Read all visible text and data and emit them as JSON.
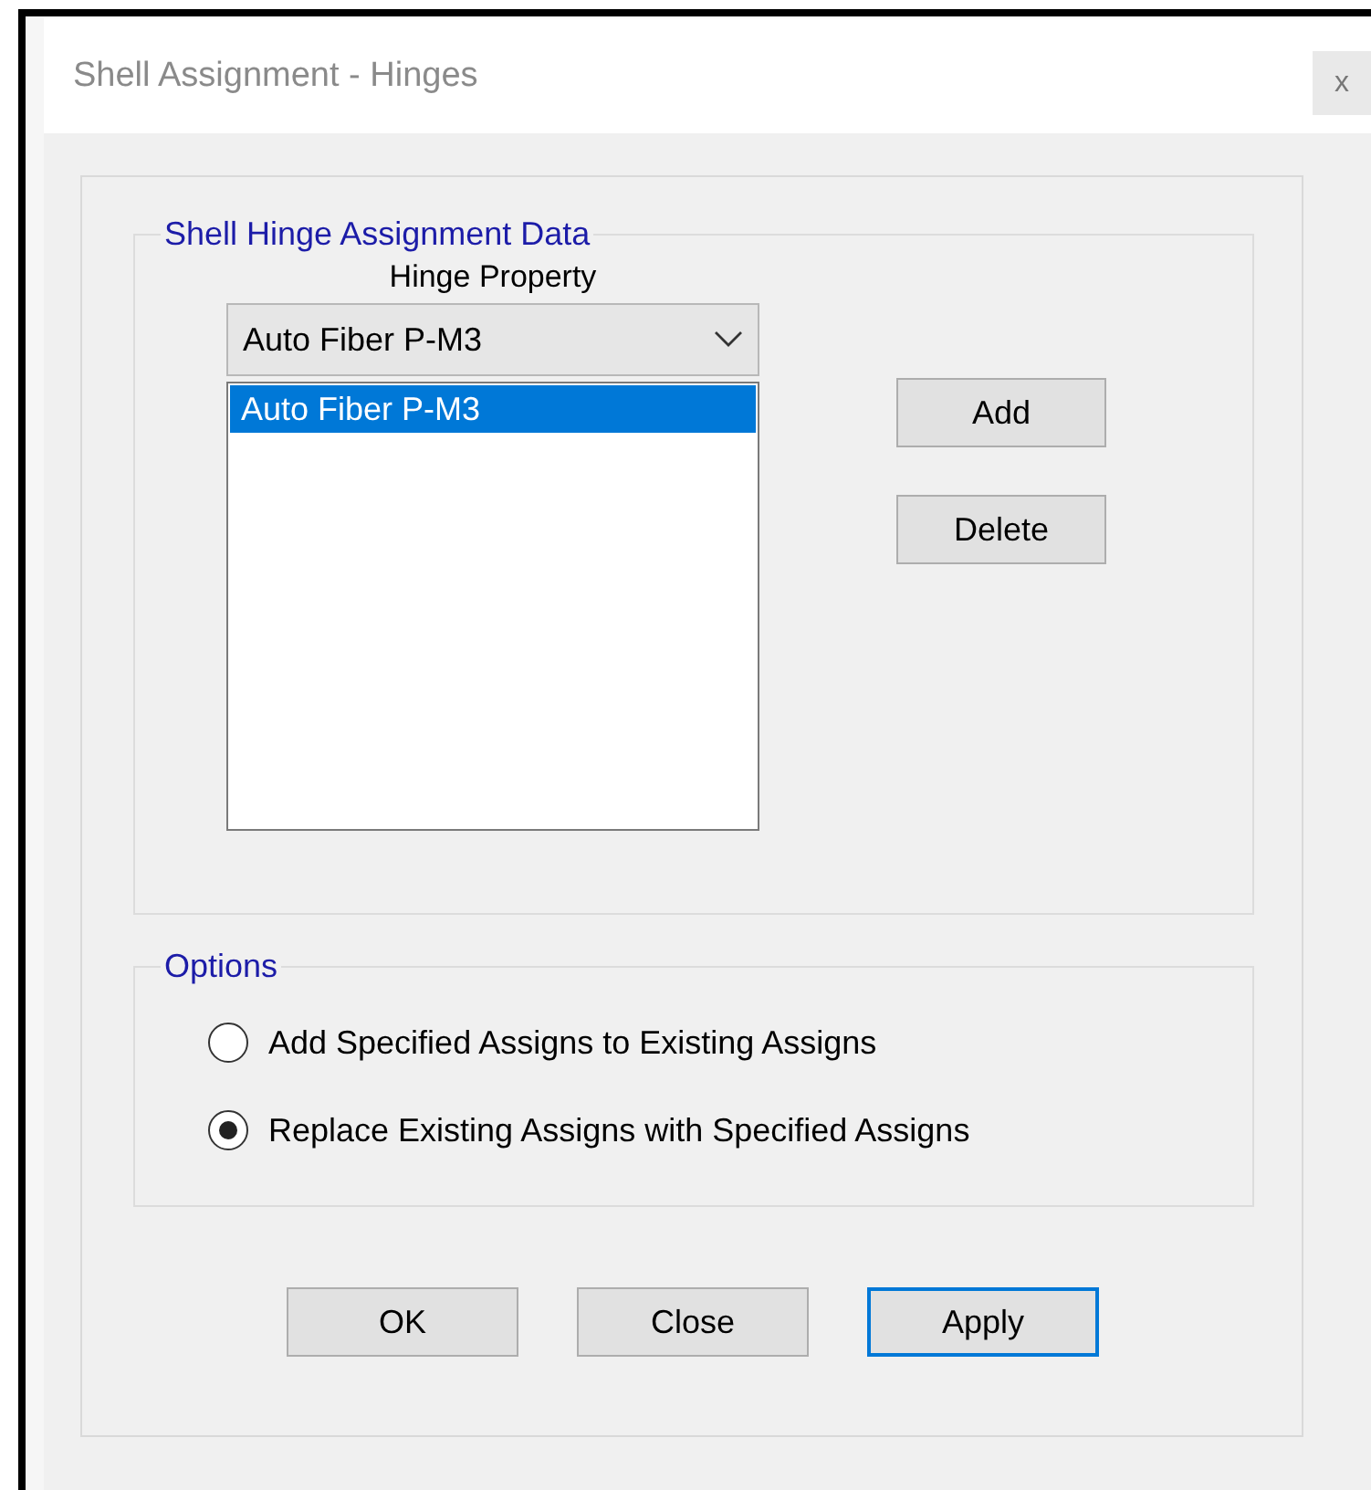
{
  "window": {
    "title": "Shell Assignment - Hinges",
    "close": "x"
  },
  "hinge_group": {
    "title": "Shell Hinge Assignment Data",
    "label": "Hinge Property",
    "dropdown_value": "Auto Fiber P-M3",
    "items": [
      {
        "label": "Auto Fiber P-M3",
        "selected": true
      }
    ],
    "buttons": [
      "Add",
      "Delete"
    ]
  },
  "options_group": {
    "title": "Options",
    "options": [
      {
        "label": "Add Specified Assigns to Existing Assigns",
        "selected": false
      },
      {
        "label": "Replace Existing Assigns with Specified Assigns",
        "selected": true
      }
    ]
  },
  "buttons": [
    {
      "label": "OK",
      "default": false
    },
    {
      "label": "Close",
      "default": false
    },
    {
      "label": "Apply",
      "default": true
    }
  ]
}
